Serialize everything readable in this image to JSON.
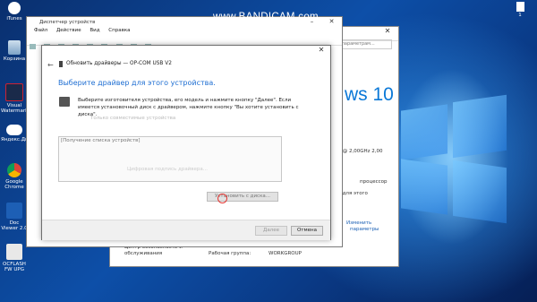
{
  "recorder": {
    "watermark": "www.BANDICAM.com"
  },
  "desktop": {
    "icons": [
      {
        "label": "iTunes"
      },
      {
        "label": "Корзина"
      },
      {
        "label": "Visual Watermark"
      },
      {
        "label": "Яндекс.Диск"
      },
      {
        "label": "Google Chrome"
      },
      {
        "label": "Doc Viewer 2.0"
      },
      {
        "label": "OCFLASH FW UPG"
      }
    ],
    "corner_icon_label": "1"
  },
  "system_window": {
    "search_placeholder": "к параметрам...",
    "brand_text": "ws 10",
    "cpu_freq": "Hz @ 2,00GHz  2,00",
    "os_type": "процессор",
    "pen_info": "ия для этого",
    "change_link": "Изменить",
    "params_link": "параметры",
    "left_label_1": "Центр безопасности и",
    "left_label_2": "обслуживания",
    "workgroup_label": "Рабочая группа:",
    "workgroup_value": "WORKGROUP"
  },
  "device_manager": {
    "title": "Диспетчер устройств",
    "menu": [
      "Файл",
      "Действие",
      "Вид",
      "Справка"
    ]
  },
  "wizard": {
    "title": "Обновить драйверы — OP-COM USB V2",
    "heading": "Выберите драйвер для этого устройства.",
    "instruction": "Выберите изготовителя устройства, его модель и нажмите кнопку \"Далее\". Если имеется установочный диск с драйвером, нажмите кнопку \"Вы хотите установить с диска\".",
    "compat_faded": "Только совместимые устройства",
    "list_loading": "[Получение списка устройств]",
    "faded_text": "Цифровая подпись драйвера...",
    "disk_button": "Установить с диска...",
    "next_button": "Далее",
    "cancel_button": "Отмена"
  }
}
